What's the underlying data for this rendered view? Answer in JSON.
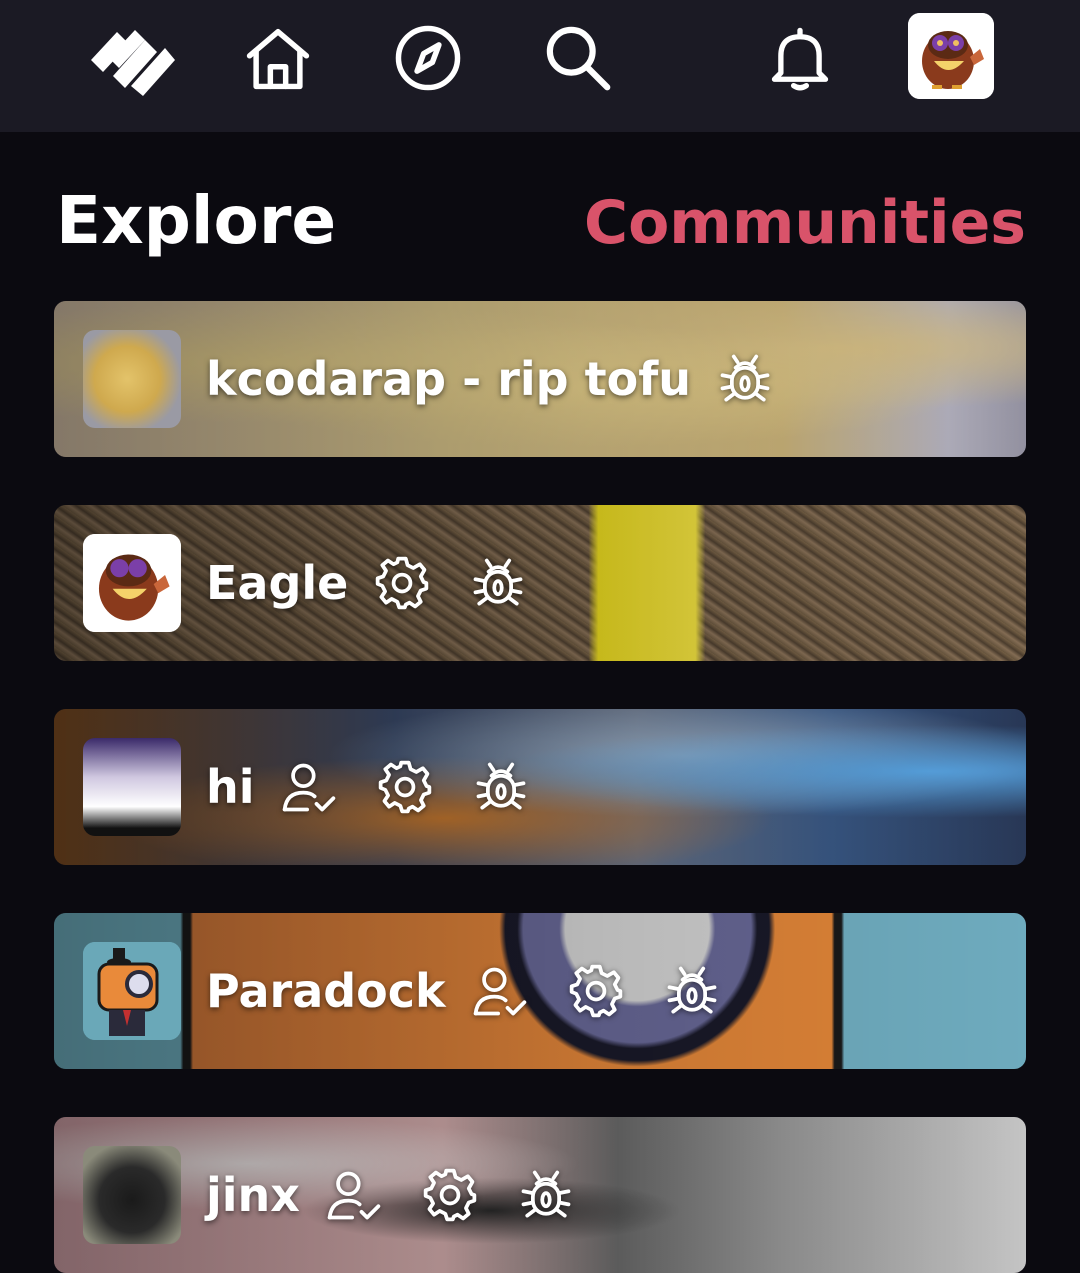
{
  "header": {
    "logo_icon": "logo-stripes-icon",
    "nav": [
      {
        "icon": "home-icon"
      },
      {
        "icon": "compass-icon"
      },
      {
        "icon": "search-icon"
      },
      {
        "icon": "bell-icon"
      }
    ],
    "profile_avatar": "eagle-thumbs-up-avatar"
  },
  "page": {
    "title": "Explore",
    "section_link": "Communities"
  },
  "communities": [
    {
      "name": "kcodarap - rip tofu",
      "badges": [
        "bug-icon"
      ]
    },
    {
      "name": "Eagle",
      "badges": [
        "gear-icon",
        "bug-icon"
      ]
    },
    {
      "name": "hi",
      "badges": [
        "user-check-icon",
        "gear-icon",
        "bug-icon"
      ]
    },
    {
      "name": "Paradock",
      "badges": [
        "user-check-icon",
        "gear-icon",
        "bug-icon"
      ]
    },
    {
      "name": "jinx",
      "badges": [
        "user-check-icon",
        "gear-icon",
        "bug-icon"
      ]
    }
  ],
  "colors": {
    "background": "#0b0a10",
    "navbar": "#1b1a24",
    "accent": "#d9536a",
    "text": "#ffffff"
  }
}
